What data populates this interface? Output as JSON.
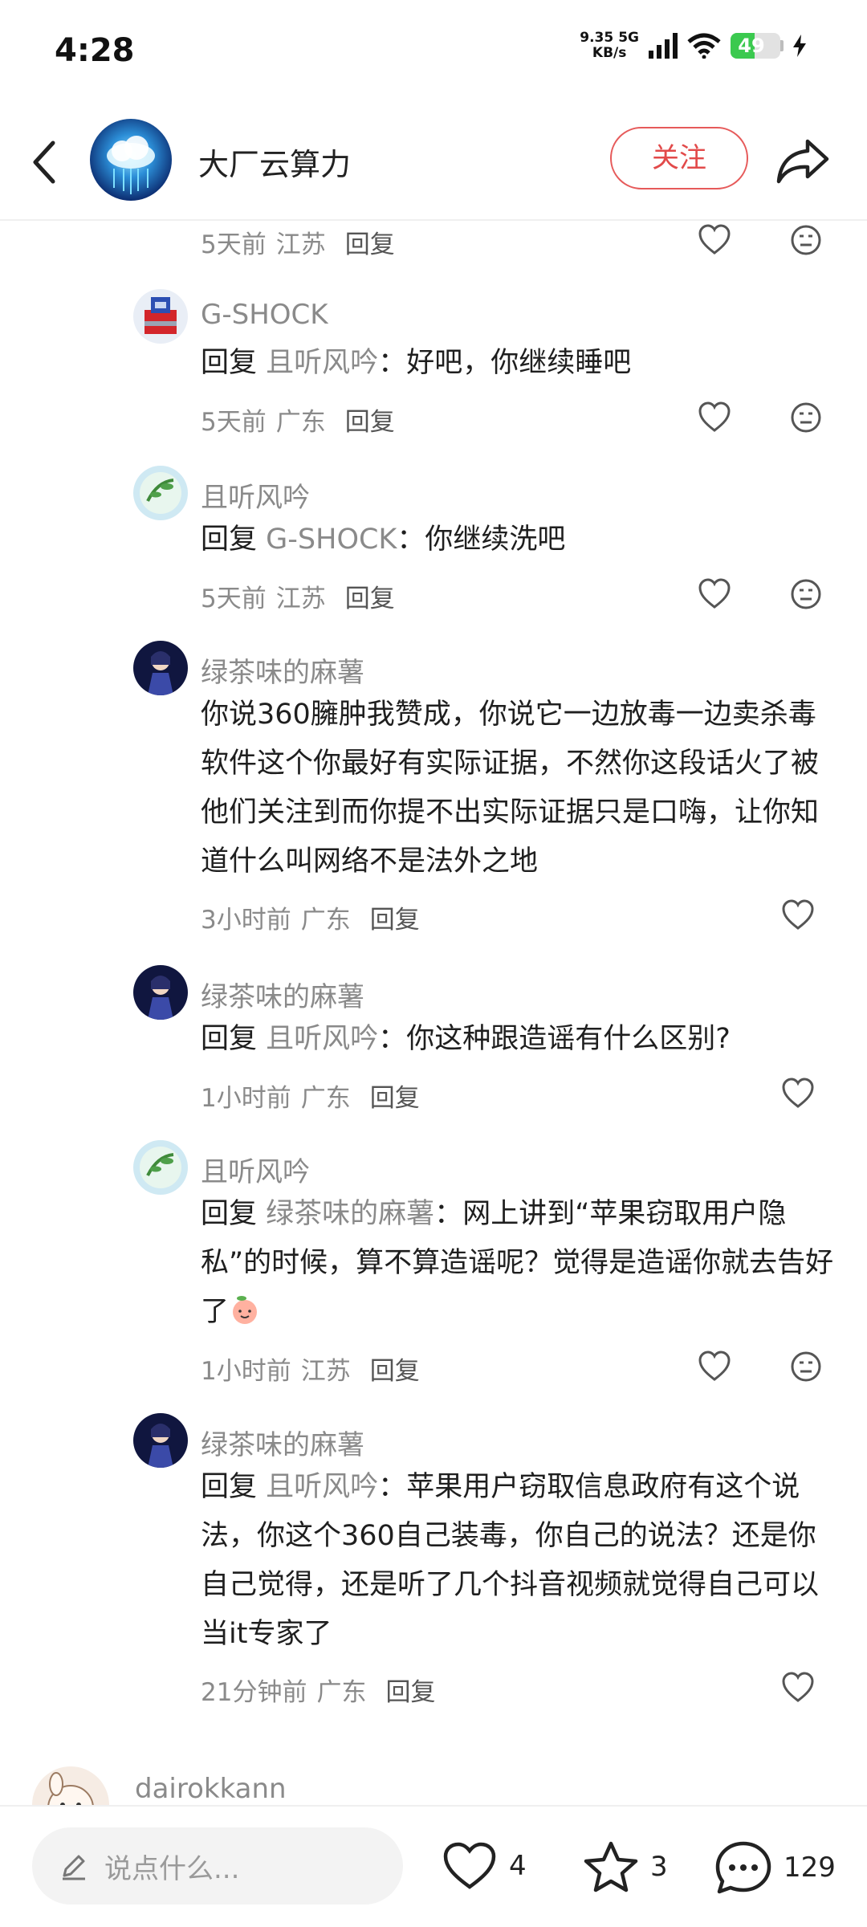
{
  "status": {
    "time": "4:28",
    "net_speed_value": "9.35",
    "net_speed_unit": "KB/s",
    "network": "5G",
    "battery": "49",
    "battery_level": 0.49
  },
  "header": {
    "account_name": "大厂云算力",
    "follow_label": "关注"
  },
  "comments": [
    {
      "id": "c0",
      "time": "5天前",
      "location": "江苏",
      "reply_label": "回复"
    },
    {
      "id": "c1",
      "name": "G-SHOCK",
      "reply_prefix": "回复",
      "reply_target": "且听风吟",
      "sep": "：",
      "text": "好吧，你继续睡吧",
      "time": "5天前",
      "location": "广东",
      "reply_label": "回复"
    },
    {
      "id": "c2",
      "name": "且听风吟",
      "reply_prefix": "回复",
      "reply_target": "G-SHOCK",
      "sep": "：",
      "text": "你继续洗吧",
      "time": "5天前",
      "location": "江苏",
      "reply_label": "回复"
    },
    {
      "id": "c3",
      "name": "绿茶味的麻薯",
      "text": "你说360臃肿我赞成，你说它一边放毒一边卖杀毒软件这个你最好有实际证据，不然你这段话火了被他们关注到而你提不出实际证据只是口嗨，让你知道什么叫网络不是法外之地",
      "time": "3小时前",
      "location": "广东",
      "reply_label": "回复"
    },
    {
      "id": "c4",
      "name": "绿茶味的麻薯",
      "reply_prefix": "回复",
      "reply_target": "且听风吟",
      "sep": "：",
      "text": "你这种跟造谣有什么区别?",
      "time": "1小时前",
      "location": "广东",
      "reply_label": "回复"
    },
    {
      "id": "c5",
      "name": "且听风吟",
      "reply_prefix": "回复",
      "reply_target": "绿茶味的麻薯",
      "sep": "：",
      "text": "网上讲到“苹果窃取用户隐私”的时候，算不算造谣呢？觉得是造谣你就去告好了",
      "time": "1小时前",
      "location": "江苏",
      "reply_label": "回复"
    },
    {
      "id": "c6",
      "name": "绿茶味的麻薯",
      "reply_prefix": "回复",
      "reply_target": "且听风吟",
      "sep": "：",
      "text": "苹果用户窃取信息政府有这个说法，你这个360自己装毒，你自己的说法？还是你自己觉得，还是听了几个抖音视频就觉得自己可以当it专家了",
      "time": "21分钟前",
      "location": "广东",
      "reply_label": "回复"
    },
    {
      "id": "c7",
      "name": "dairokkann"
    }
  ],
  "bottom": {
    "input_placeholder": "说点什么...",
    "like_count": "4",
    "fav_count": "3",
    "comment_count": "129"
  },
  "colors": {
    "accent": "#e24a4a",
    "battery_green": "#3bc94f",
    "muted_text": "#8a8a8a"
  },
  "icons": [
    "back-icon",
    "share-icon",
    "heart-icon",
    "neutral-face-icon",
    "pencil-icon",
    "star-icon",
    "chat-bubble-icon",
    "peach-emoji-icon"
  ]
}
